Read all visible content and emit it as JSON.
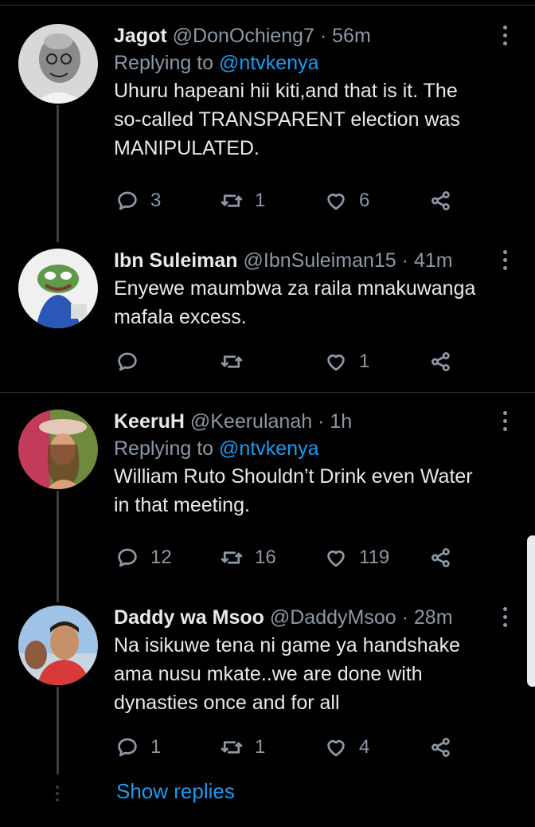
{
  "tweets": [
    {
      "name": "Jagot",
      "handle": "@DonOchieng7",
      "sep": "·",
      "time": "56m",
      "replying_prefix": "Replying to",
      "replying_to": "@ntvkenya",
      "text_lines": [
        "Uhuru hapeani hii kiti,and that is it. The",
        "so-called TRANSPARENT election was",
        "MANIPULATED."
      ],
      "replies": "3",
      "retweets": "1",
      "likes": "6"
    },
    {
      "name": "Ibn Suleiman",
      "handle": "@IbnSuleiman15",
      "sep": "·",
      "time": "41m",
      "text_lines": [
        "Enyewe maumbwa za raila mnakuwanga",
        "mafala excess."
      ],
      "replies": "",
      "retweets": "",
      "likes": "1"
    },
    {
      "name": "KeeruH",
      "handle": "@Keerulanah",
      "sep": "·",
      "time": "1h",
      "replying_prefix": "Replying to",
      "replying_to": "@ntvkenya",
      "text_lines": [
        "William Ruto Shouldn’t Drink even Water",
        "in that meeting."
      ],
      "replies": "12",
      "retweets": "16",
      "likes": "119"
    },
    {
      "name": "Daddy wa Msoo",
      "handle": "@DaddyMsoo",
      "sep": "·",
      "time": "28m",
      "text_lines": [
        "Na isikuwe tena ni game ya handshake",
        "ama nusu mkate..we are done with",
        "dynasties once and for all"
      ],
      "replies": "1",
      "retweets": "1",
      "likes": "4"
    }
  ],
  "show_replies": "Show replies",
  "colors": {
    "background": "#000000",
    "text": "#e7e9ea",
    "secondary": "#8b98a5",
    "accent": "#1d9bf0"
  },
  "icons": [
    "reply-icon",
    "retweet-icon",
    "like-icon",
    "share-icon",
    "more-icon"
  ]
}
